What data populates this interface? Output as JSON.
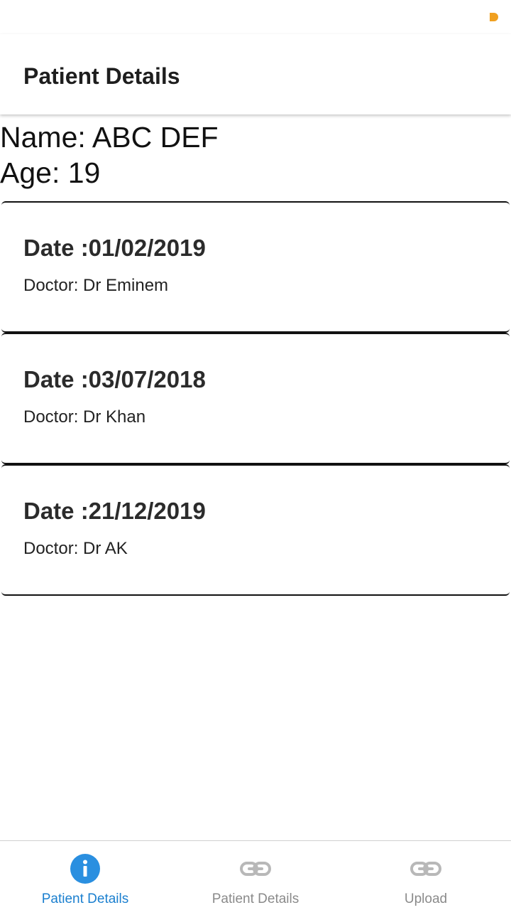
{
  "colors": {
    "accent": "#2a8fe0",
    "active_label": "#1a7fcf",
    "inactive": "#9e9e9e",
    "status_dot": "#f0a020"
  },
  "header": {
    "title": "Patient Details"
  },
  "patient": {
    "name_line": "Name: ABC DEF",
    "age_line": "Age: 19"
  },
  "visits": [
    {
      "date": "Date :01/02/2019",
      "doctor": "Doctor: Dr Eminem"
    },
    {
      "date": "Date :03/07/2018",
      "doctor": "Doctor: Dr Khan"
    },
    {
      "date": "Date :21/12/2019",
      "doctor": "Doctor: Dr AK"
    }
  ],
  "bottom_nav": {
    "items": [
      {
        "label": "Patient Details",
        "icon": "info-icon",
        "active": true
      },
      {
        "label": "Patient Details",
        "icon": "link-icon",
        "active": false
      },
      {
        "label": "Upload",
        "icon": "link-icon",
        "active": false
      }
    ]
  }
}
